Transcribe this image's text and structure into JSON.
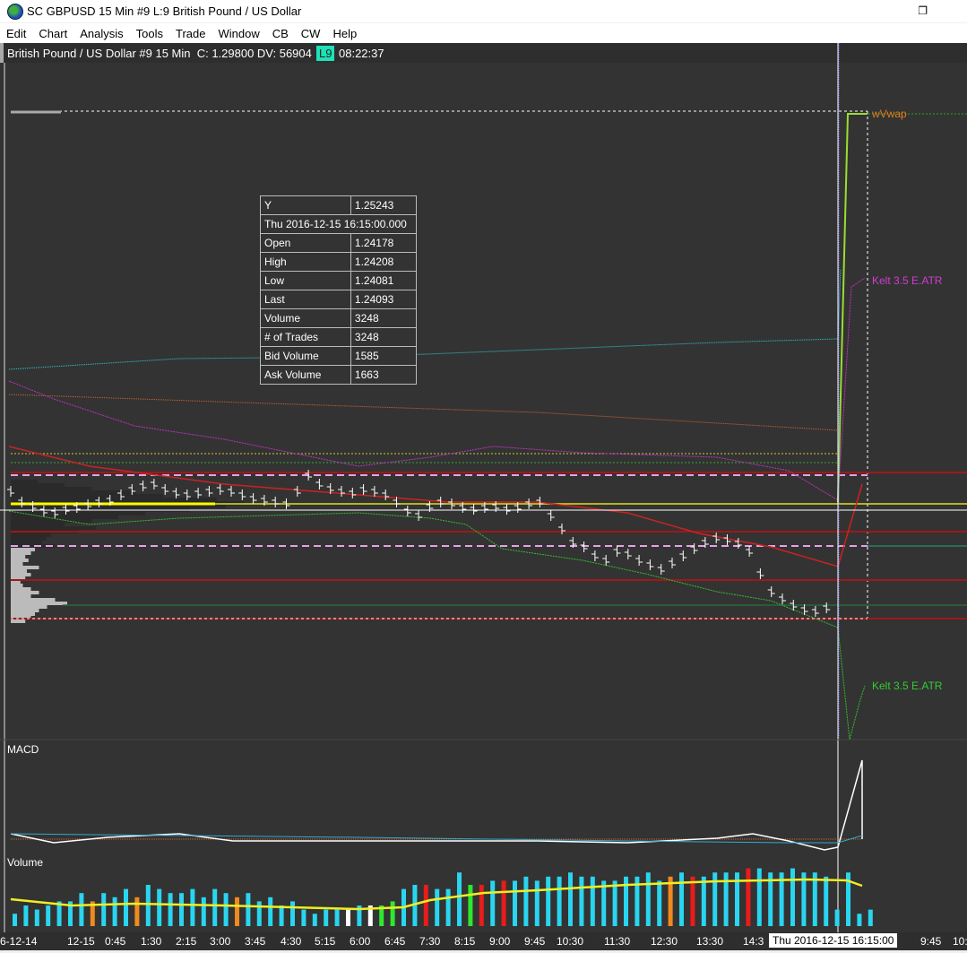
{
  "window": {
    "title": "SC GBPUSD  15 Min   #9  L:9  British Pound / US Dollar"
  },
  "menu": [
    "Edit",
    "Chart",
    "Analysis",
    "Tools",
    "Trade",
    "Window",
    "CB",
    "CW",
    "Help"
  ],
  "chart_header": {
    "text": "British Pound / US Dollar #9 15 Min  C: 1.29800 DV: 56904",
    "badge": "L9",
    "time": "08:22:37",
    "badge_color": "#1de2b8"
  },
  "data_window": [
    [
      "Y",
      "1.25243"
    ],
    [
      "Thu 2016-12-15  16:15:00.000",
      ""
    ],
    [
      "Open",
      "1.24178"
    ],
    [
      "High",
      "1.24208"
    ],
    [
      "Low",
      "1.24081"
    ],
    [
      "Last",
      "1.24093"
    ],
    [
      "Volume",
      "3248"
    ],
    [
      "# of Trades",
      "3248"
    ],
    [
      "Bid Volume",
      "1585"
    ],
    [
      "Ask Volume",
      "1663"
    ]
  ],
  "study_labels": {
    "wvwap": "wVwap",
    "kelt_upper": "Kelt 3.5 E.ATR",
    "kelt_lower": "Kelt 3.5 E.ATR",
    "macd": "MACD",
    "volume": "Volume"
  },
  "time_axis": {
    "labels": [
      "6-12-14",
      "12-15",
      "0:45",
      "1:30",
      "2:15",
      "3:00",
      "3:45",
      "4:30",
      "5:15",
      "6:00",
      "6:45",
      "7:30",
      "8:15",
      "9:00",
      "9:45",
      "10:30",
      "11:30",
      "12:30",
      "13:30",
      "14:3",
      "9:45",
      "10:"
    ],
    "cursor_label": "Thu 2016-12-15   16:15:00"
  },
  "volume_bars": {
    "values": [
      3,
      5,
      4,
      5,
      6,
      6,
      8,
      6,
      8,
      7,
      9,
      7,
      10,
      9,
      8,
      8,
      9,
      7,
      9,
      8,
      7,
      8,
      6,
      7,
      5,
      6,
      4,
      3,
      4,
      4,
      4,
      5,
      5,
      5,
      6,
      9,
      10,
      10,
      9,
      9,
      13,
      10,
      10,
      11,
      11,
      11,
      12,
      11,
      12,
      12,
      13,
      12,
      12,
      11,
      11,
      12,
      12,
      13,
      11,
      12,
      13,
      12,
      12,
      13,
      13,
      13,
      14,
      14,
      13,
      13,
      14,
      13,
      13,
      12,
      4,
      13,
      3,
      4
    ],
    "colors": "cccccccocccoccccccccocccccccccwcwggccrcccgrcrccccccccccccccocrccccrccccccccccccwcwc"
  }
}
